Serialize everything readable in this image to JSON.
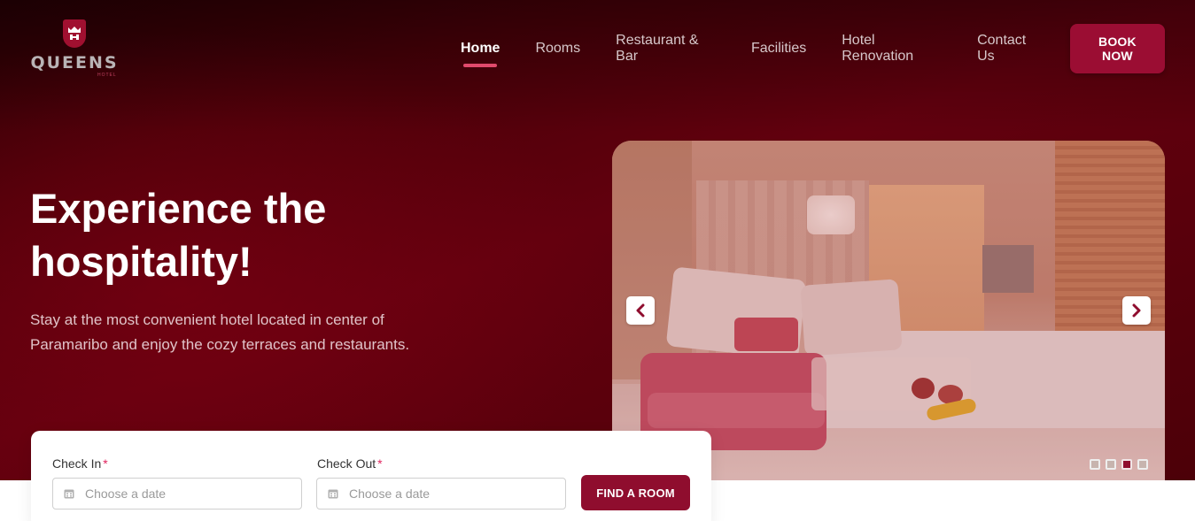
{
  "brand": {
    "name": "QUEENS",
    "sub": "HOTEL"
  },
  "nav": {
    "items": [
      {
        "label": "Home",
        "active": true
      },
      {
        "label": "Rooms",
        "active": false
      },
      {
        "label": "Restaurant & Bar",
        "active": false
      },
      {
        "label": "Facilities",
        "active": false
      },
      {
        "label": "Hotel Renovation",
        "active": false
      },
      {
        "label": "Contact Us",
        "active": false
      }
    ],
    "cta": "BOOK NOW"
  },
  "hero": {
    "headline_line1": "Experience the",
    "headline_line2": "hospitality!",
    "description": "Stay at the most convenient hotel located in center of Paramaribo and enjoy the cozy terraces and restaurants."
  },
  "slider": {
    "prev_icon": "chevron-left-icon",
    "next_icon": "chevron-right-icon",
    "slide_count": 4,
    "active_slide": 3
  },
  "booking": {
    "check_in": {
      "label": "Check In",
      "required_mark": "*",
      "placeholder": "Choose a date"
    },
    "check_out": {
      "label": "Check Out",
      "required_mark": "*",
      "placeholder": "Choose a date"
    },
    "submit": "FIND A ROOM"
  },
  "colors": {
    "accent": "#8f0d2e",
    "hero_dark": "#4a0008",
    "nav_underline": "#e04a6c",
    "required": "#e0245e"
  }
}
